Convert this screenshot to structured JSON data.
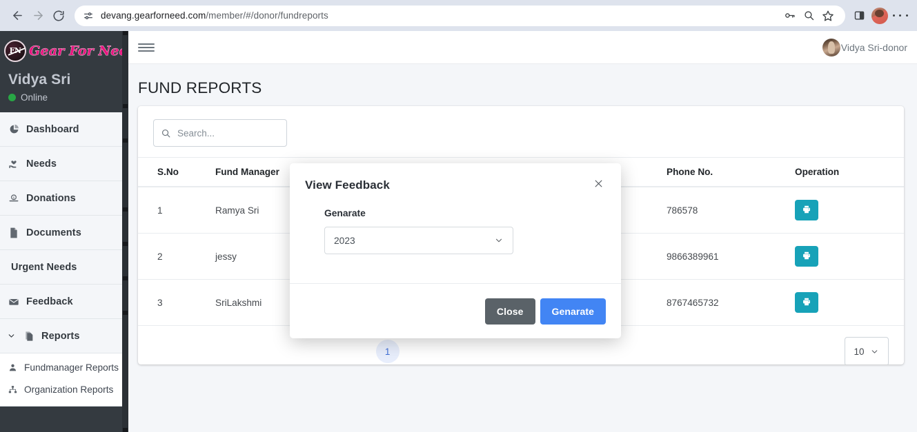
{
  "browser": {
    "back_icon": "back-arrow-icon",
    "forward_icon": "forward-arrow-icon",
    "reload_icon": "reload-icon",
    "site_settings_icon": "site-settings-icon",
    "url_main": "devang.gearforneed.com",
    "url_path": "/member/#/donor/fundreports",
    "password_icon": "password-key-icon",
    "zoom_icon": "zoom-search-icon",
    "bookmark_icon": "bookmark-star-icon",
    "sidepanel_icon": "side-panel-icon",
    "profile_icon": "profile-avatar-icon",
    "menu_icon": "chrome-menu-icon"
  },
  "sidebar": {
    "brand_initials": "FN",
    "brand_name": "Gear For Need",
    "user_name": "Vidya Sri",
    "status": "Online",
    "items": [
      {
        "label": "Dashboard",
        "icon": "pie-chart-icon"
      },
      {
        "label": "Needs",
        "icon": "hand-heart-icon"
      },
      {
        "label": "Donations",
        "icon": "donate-money-icon"
      },
      {
        "label": "Documents",
        "icon": "document-file-icon"
      },
      {
        "label": "Urgent Needs",
        "icon": "none"
      },
      {
        "label": "Feedback",
        "icon": "envelope-icon"
      }
    ],
    "reports": {
      "label": "Reports",
      "icon": "copy-files-icon",
      "caret": "chevron-down-icon",
      "sub_items": [
        {
          "label": "Fundmanager Reports",
          "icon": "user-person-icon"
        },
        {
          "label": "Organization Reports",
          "icon": "sitemap-icon"
        }
      ]
    }
  },
  "topbar": {
    "hamburger_icon": "hamburger-menu-icon",
    "user_label": "Vidya Sri-donor"
  },
  "page": {
    "title": "FUND REPORTS"
  },
  "search": {
    "placeholder": "Search...",
    "value": "",
    "icon": "search-icon"
  },
  "table": {
    "columns": [
      "S.No",
      "Fund Manager",
      "Phone No.",
      "Operation"
    ],
    "rows": [
      {
        "sno": "1",
        "fund_manager": "Ramya Sri",
        "phone": "786578",
        "op_icon": "print-icon"
      },
      {
        "sno": "2",
        "fund_manager": "jessy",
        "phone": "9866389961",
        "op_icon": "print-icon"
      },
      {
        "sno": "3",
        "fund_manager": "SriLakshmi",
        "phone": "8767465732",
        "op_icon": "print-icon"
      }
    ]
  },
  "pagination": {
    "per_page_value": "10",
    "caret_icon": "chevron-down-icon",
    "active_page": "1"
  },
  "modal": {
    "title": "View Feedback",
    "close_icon": "close-x-icon",
    "field_label": "Genarate",
    "select_value": "2023",
    "select_caret": "chevron-down-icon",
    "close_button": "Close",
    "generate_button": "Genarate"
  },
  "colors": {
    "sidebar_bg": "#343a40",
    "accent_blue": "#4285f4",
    "accent_teal": "#17a2b8",
    "brand_pink": "#e8157f",
    "online_green": "#28a745",
    "gray_button": "#5a6268"
  }
}
